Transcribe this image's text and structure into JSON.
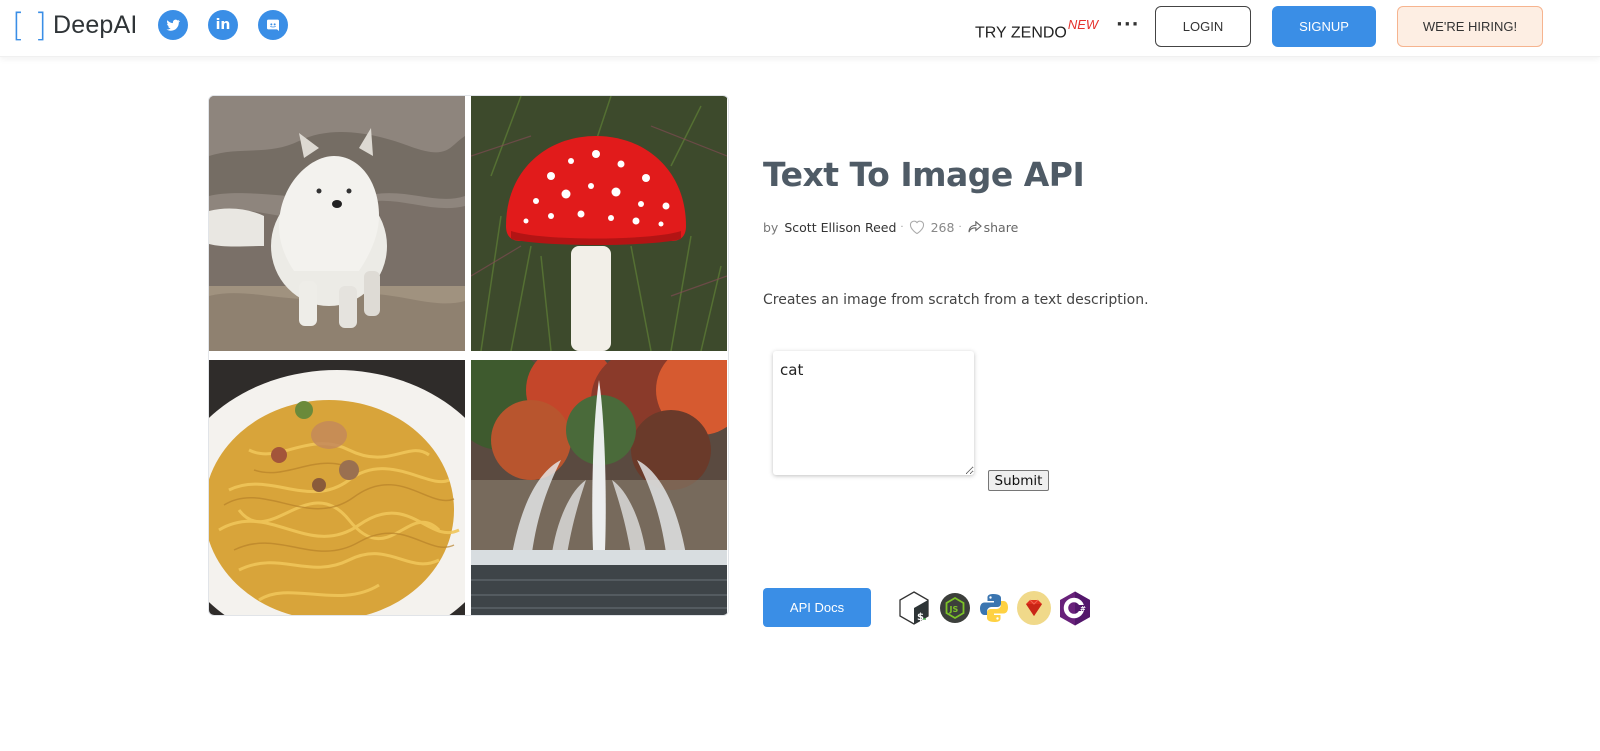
{
  "header": {
    "logo": {
      "bracket_left": "[",
      "bracket_right": "]",
      "name": "DeepAI"
    },
    "social": [
      {
        "name": "twitter",
        "icon": "twitter-icon"
      },
      {
        "name": "linkedin",
        "icon": "linkedin-icon",
        "glyph": "in"
      },
      {
        "name": "discord",
        "icon": "discord-icon"
      }
    ],
    "nav": {
      "zendo_label": "TRY ZENDO",
      "zendo_badge": "NEW",
      "more_label": "···"
    },
    "buttons": {
      "login": "LOGIN",
      "signup": "SIGNUP",
      "hiring": "WE'RE HIRING!"
    }
  },
  "gallery": {
    "images": [
      {
        "subject": "white wolf on rocks"
      },
      {
        "subject": "red fly agaric mushroom in grass"
      },
      {
        "subject": "plate of pasta"
      },
      {
        "subject": "fountain with autumn trees"
      }
    ]
  },
  "main": {
    "title": "Text To Image API",
    "by_label": "by",
    "author": "Scott Ellison Reed",
    "separator": "·",
    "likes": "268",
    "share_label": "share",
    "description": "Creates an image from scratch from a text description.",
    "prompt_value": "cat",
    "submit_label": "Submit",
    "api_docs_label": "API Docs",
    "languages": [
      {
        "name": "bash",
        "icon": "bash-icon"
      },
      {
        "name": "nodejs",
        "icon": "nodejs-icon"
      },
      {
        "name": "python",
        "icon": "python-icon"
      },
      {
        "name": "ruby",
        "icon": "ruby-icon"
      },
      {
        "name": "csharp",
        "icon": "csharp-icon"
      }
    ]
  },
  "colors": {
    "brand_blue": "#3a8ee6",
    "title": "#4f5b66",
    "new_badge": "#e5322d",
    "hiring_bg": "#fdeee3",
    "hiring_border": "#f6b48f"
  }
}
